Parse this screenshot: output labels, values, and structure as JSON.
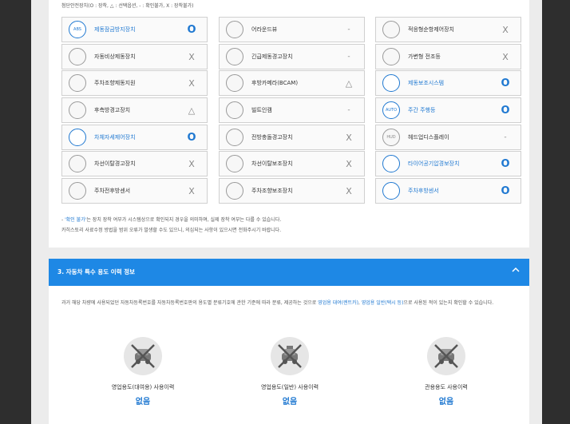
{
  "legend": "첨단안전장치(O : 장착, △ : 선택옵션, - : 확인불가, X : 장착불가)",
  "columns": [
    [
      {
        "name": "제동잠금방지장치",
        "status": "O",
        "icon": "abs-icon",
        "icon_text": "ABS",
        "highlight": true
      },
      {
        "name": "자동비상제동장치",
        "status": "X",
        "icon": "emergency-brake-icon",
        "icon_text": "",
        "highlight": false
      },
      {
        "name": "주차조향제동지원",
        "status": "X",
        "icon": "parking-steer-icon",
        "icon_text": "",
        "highlight": false
      },
      {
        "name": "후측방경고장치",
        "status": "△",
        "icon": "blind-spot-icon",
        "icon_text": "",
        "highlight": false
      },
      {
        "name": "차체자세제어장치",
        "status": "O",
        "icon": "stability-control-icon",
        "icon_text": "",
        "highlight": true
      },
      {
        "name": "차선이탈경고장치",
        "status": "X",
        "icon": "lane-departure-icon",
        "icon_text": "",
        "highlight": false
      },
      {
        "name": "주차전후방센서",
        "status": "X",
        "icon": "parking-sensor-icon",
        "icon_text": "",
        "highlight": false
      }
    ],
    [
      {
        "name": "어라운드뷰",
        "status": "-",
        "icon": "around-view-icon",
        "icon_text": "",
        "highlight": false
      },
      {
        "name": "긴급제동경고장치",
        "status": "-",
        "icon": "emergency-warning-icon",
        "icon_text": "",
        "highlight": false
      },
      {
        "name": "후방카메라(BCAM)",
        "status": "△",
        "icon": "rear-camera-icon",
        "icon_text": "",
        "highlight": false
      },
      {
        "name": "빌트인캠",
        "status": "-",
        "icon": "builtin-cam-icon",
        "icon_text": "",
        "highlight": false
      },
      {
        "name": "전방충돌경고장치",
        "status": "X",
        "icon": "forward-collision-icon",
        "icon_text": "",
        "highlight": false
      },
      {
        "name": "차선이탈보조장치",
        "status": "X",
        "icon": "lane-assist-icon",
        "icon_text": "",
        "highlight": false
      },
      {
        "name": "주차조향보조장치",
        "status": "X",
        "icon": "parking-assist-icon",
        "icon_text": "",
        "highlight": false
      }
    ],
    [
      {
        "name": "적응형순항제어장치",
        "status": "X",
        "icon": "adaptive-cruise-icon",
        "icon_text": "",
        "highlight": false
      },
      {
        "name": "가변형 전조등",
        "status": "X",
        "icon": "adaptive-headlight-icon",
        "icon_text": "",
        "highlight": false
      },
      {
        "name": "제동보조시스템",
        "status": "O",
        "icon": "brake-assist-icon",
        "icon_text": "",
        "highlight": true
      },
      {
        "name": "주간 주행등",
        "status": "O",
        "icon": "daytime-light-icon",
        "icon_text": "AUTO",
        "highlight": true
      },
      {
        "name": "헤드업디스플레이",
        "status": "-",
        "icon": "hud-icon",
        "icon_text": "HUD",
        "highlight": false
      },
      {
        "name": "타이어공기압경보장치",
        "status": "O",
        "icon": "tire-pressure-icon",
        "icon_text": "",
        "highlight": true
      },
      {
        "name": "주차후방센서",
        "status": "O",
        "icon": "rear-sensor-icon",
        "icon_text": "",
        "highlight": true
      }
    ]
  ],
  "notes": {
    "line1_prefix": "- ",
    "line1_highlight": "'확인 불가'",
    "line1_rest": "는 장치 장착 여부가 시스템상으로 확인되지 경우을 의미하며, 실제 장착 여부는 다를 수 있습니다.",
    "line2": "카히스토리 사료수정 방법을 범위 오류가 발생할 수도 있으니, 의심되는 사항이 있으시면 전화주시기 바랍니다."
  },
  "section": {
    "title": "3. 자동차 특수 용도 이력 정보",
    "description_prefix": "과거 해당 차량에 사용되었던 자동차등록번호를 자동차등록번호판의 용도별 분류기호에 관한 기준에 따라 분류, 제공하는 것으로 ",
    "link1": "영업용 대여(렌트카)",
    "sep": ", ",
    "link2": "영업용 일반(택시 등)",
    "description_suffix": "으로 사용된 적이 있는지 확인할 수 있습니다."
  },
  "usage": [
    {
      "label": "영업용도(대여용) 사용이력",
      "value": "없음",
      "icon": "rental-car-icon"
    },
    {
      "label": "영업용도(일반) 사용이력",
      "value": "없음",
      "icon": "taxi-icon"
    },
    {
      "label": "관용용도 사용이력",
      "value": "없음",
      "icon": "government-car-icon"
    }
  ],
  "colors": {
    "accent": "#1e88e5",
    "highlight_text": "#1f78d1"
  }
}
